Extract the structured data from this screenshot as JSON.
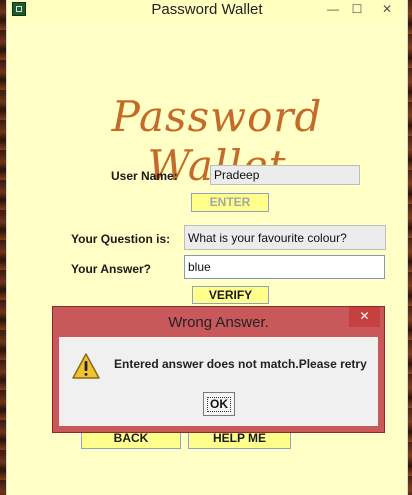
{
  "window": {
    "title": "Password Wallet",
    "min_glyph": "—",
    "max_glyph": "☐",
    "close_glyph": "✕"
  },
  "brand": "Password Wallet",
  "form": {
    "username_label": "User Name:",
    "username_value": "Pradeep",
    "enter_label": "ENTER",
    "question_label": "Your Question is:",
    "question_value": "What is your favourite colour?",
    "answer_label": "Your Answer?",
    "answer_value": "blue",
    "verify_label": "VERIFY",
    "back_label": "BACK",
    "help_label": "HELP ME"
  },
  "dialog": {
    "title": "Wrong Answer.",
    "close_glyph": "✕",
    "message": "Entered answer does not match.Please retry",
    "ok_label": "OK",
    "icon": "warning-icon"
  },
  "colors": {
    "panel_bg": "#ffffc6",
    "button_bg": "#ffff8c",
    "brand": "#c56a28",
    "dialog_frame": "#c9585a"
  }
}
